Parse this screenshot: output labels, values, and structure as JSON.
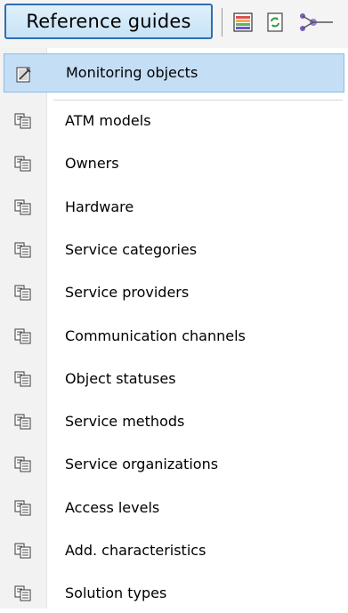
{
  "toolbar": {
    "reference_button_label": "Reference guides",
    "icons": [
      "color-list-icon",
      "refresh-document-icon",
      "network-icon"
    ]
  },
  "menu": {
    "selected": {
      "label": "Monitoring objects",
      "icon": "monitoring-document-icon"
    },
    "items": [
      {
        "label": "ATM models",
        "icon": "copy-documents-icon"
      },
      {
        "label": "Owners",
        "icon": "copy-documents-icon"
      },
      {
        "label": "Hardware",
        "icon": "copy-documents-icon"
      },
      {
        "label": "Service categories",
        "icon": "copy-documents-icon"
      },
      {
        "label": "Service providers",
        "icon": "copy-documents-icon"
      },
      {
        "label": "Communication channels",
        "icon": "copy-documents-icon"
      },
      {
        "label": "Object statuses",
        "icon": "copy-documents-icon"
      },
      {
        "label": "Service methods",
        "icon": "copy-documents-icon"
      },
      {
        "label": "Service organizations",
        "icon": "copy-documents-icon"
      },
      {
        "label": "Access levels",
        "icon": "copy-documents-icon"
      },
      {
        "label": "Add. characteristics",
        "icon": "copy-documents-icon"
      },
      {
        "label": "Solution types",
        "icon": "copy-documents-icon"
      }
    ]
  },
  "colors": {
    "selection_bg": "#c4def6",
    "selection_border": "#8ebbe6",
    "button_border": "#2f6fb0"
  }
}
